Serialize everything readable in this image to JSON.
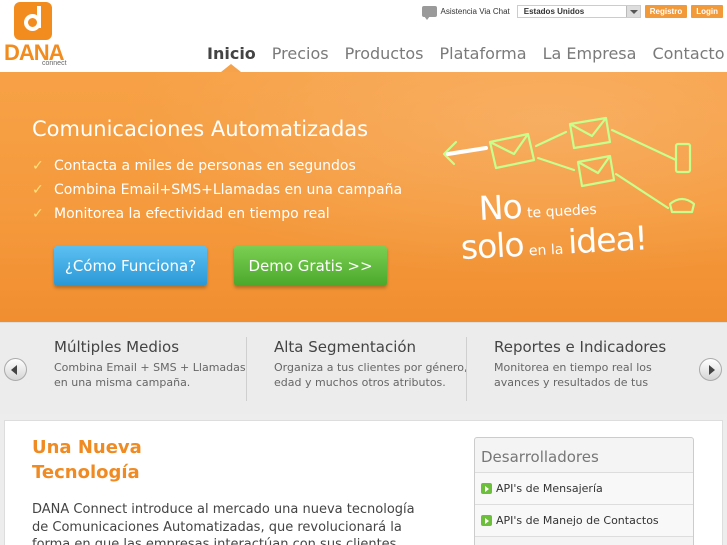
{
  "header": {
    "logo_word": "DANA",
    "logo_sub": "connect",
    "chat_label": "Asistencia Via Chat",
    "country": "Estados Unidos",
    "registro": "Registro",
    "login": "Login"
  },
  "nav": [
    {
      "label": "Inicio",
      "active": true
    },
    {
      "label": "Precios"
    },
    {
      "label": "Productos"
    },
    {
      "label": "Plataforma"
    },
    {
      "label": "La Empresa"
    },
    {
      "label": "Contacto"
    }
  ],
  "banner": {
    "headline": "Comunicaciones Automatizadas",
    "bullets": [
      "Contacta a miles de personas en segundos",
      "Combina Email+SMS+Llamadas en una campaña",
      "Monitorea la efectividad en tiempo real"
    ],
    "btn_como": "¿Cómo Funciona?",
    "btn_demo": "Demo Gratis >>",
    "slogan": {
      "no": "No",
      "te_quedes": "te quedes",
      "solo": "solo",
      "en_la": "en la",
      "idea": "idea!"
    },
    "accent": "#f59a3d",
    "illus_color": "#b9f57a"
  },
  "features": [
    {
      "title": "Múltiples Medios",
      "desc": "Combina Email + SMS + Llamadas en una misma campaña."
    },
    {
      "title": "Alta Segmentación",
      "desc": "Organiza a tus clientes por género, edad y muchos otros atributos."
    },
    {
      "title": "Reportes e Indicadores",
      "desc": "Monitorea en tiempo real los avances y resultados de tus"
    }
  ],
  "content": {
    "title": "Una Nueva Tecnología",
    "body": "DANA Connect introduce al mercado una nueva tecnología de Comunicaciones Automatizadas, que revolucionará la forma en que las empresas interactúan con sus clientes.",
    "dev_title": "Desarrolladores",
    "dev_items": [
      "API's de Mensajería",
      "API's de Manejo de Contactos"
    ]
  },
  "icons": {
    "check": "check-icon",
    "chat": "chat-icon",
    "arrow": "arrow-icon"
  }
}
